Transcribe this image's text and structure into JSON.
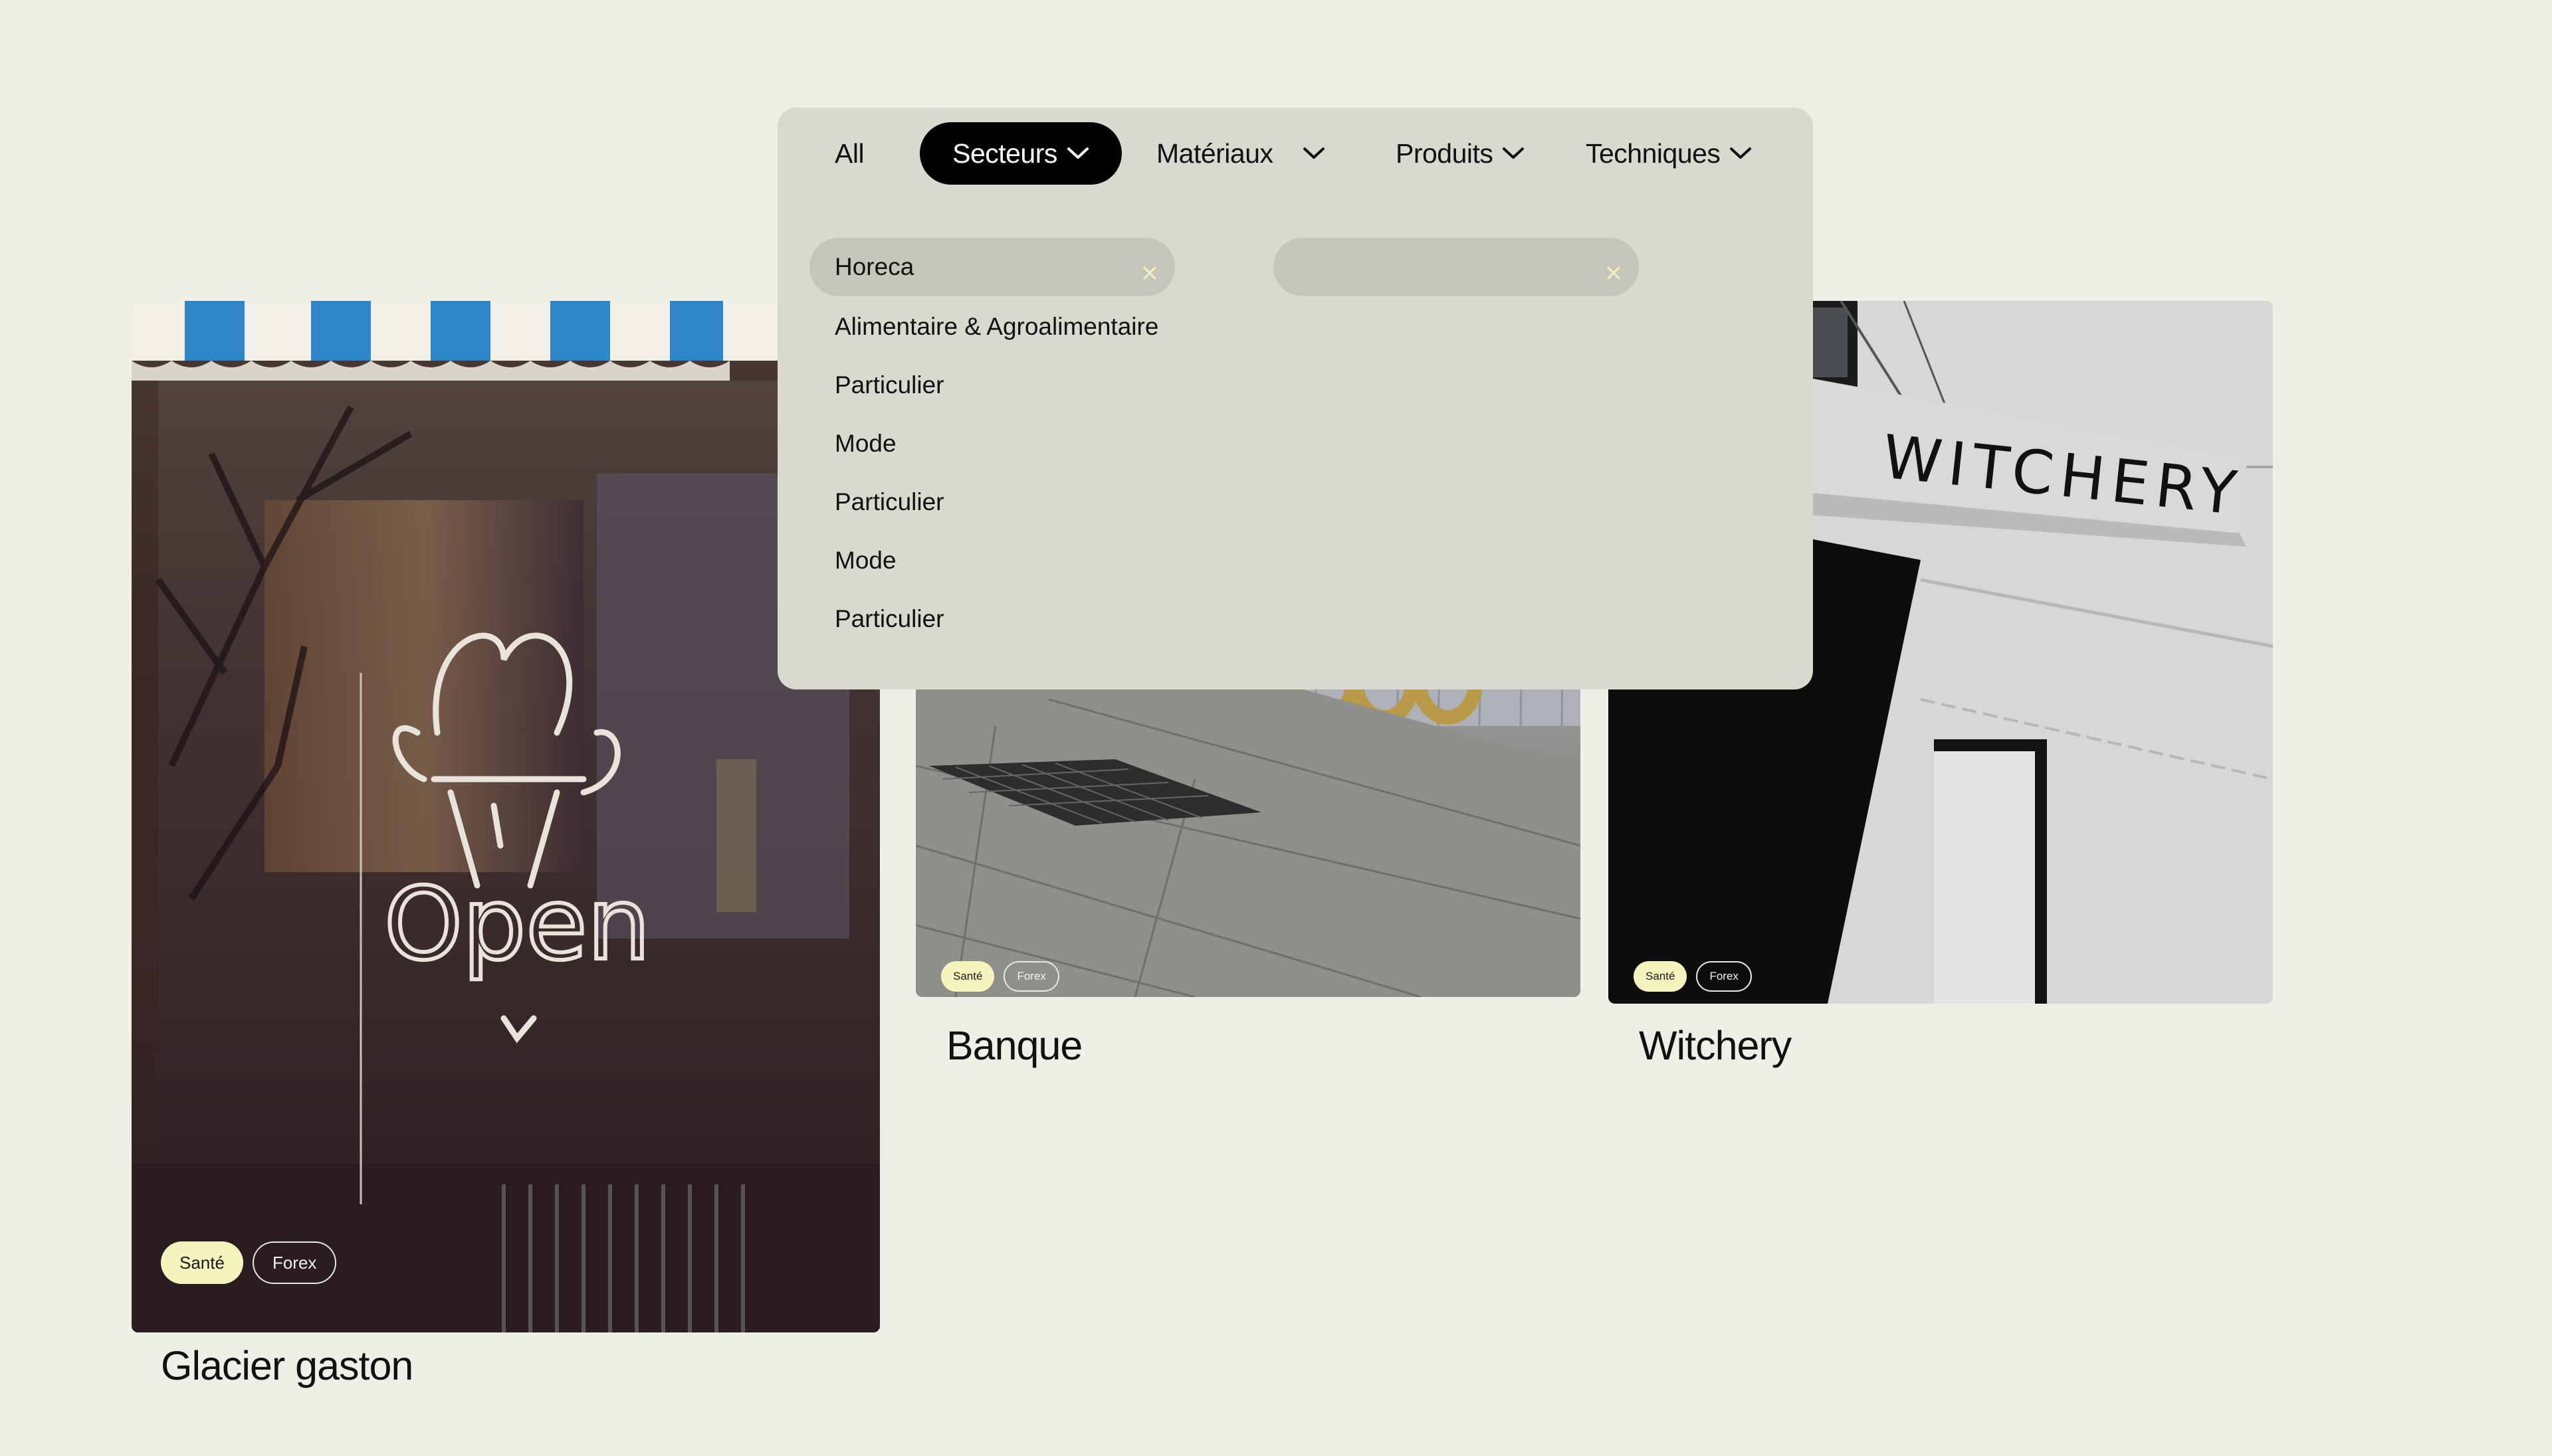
{
  "filters": {
    "tabs": [
      {
        "label": "All"
      },
      {
        "label": "Secteurs"
      },
      {
        "label": "Matériaux"
      },
      {
        "label": "Produits"
      },
      {
        "label": "Techniques"
      }
    ],
    "active_tab": "Secteurs",
    "selected_chips": [
      {
        "label": "Horeca"
      },
      {
        "label": ""
      }
    ],
    "options": [
      "Alimentaire & Agroalimentaire",
      "Particulier",
      "Mode",
      "Particulier",
      "Mode",
      "Particulier"
    ]
  },
  "projects": [
    {
      "title": "Glacier gaston",
      "tags": [
        "Santé",
        "Forex"
      ],
      "neon_text": "Open"
    },
    {
      "title": "Banque",
      "tags": [
        "Santé",
        "Forex"
      ]
    },
    {
      "title": "Witchery",
      "tags": [
        "Santé",
        "Forex"
      ],
      "sign_text": "WITCHERY"
    }
  ],
  "colors": {
    "page_background": "#efeee7",
    "panel_background": "#dad9cf",
    "chip_background": "#c6c5b9",
    "active_tab_background": "#000000",
    "tag_fill": "#f5f4bf",
    "chip_close_icon": "#f3f1c4"
  },
  "icons": [
    "chevron-down-icon",
    "close-icon"
  ]
}
